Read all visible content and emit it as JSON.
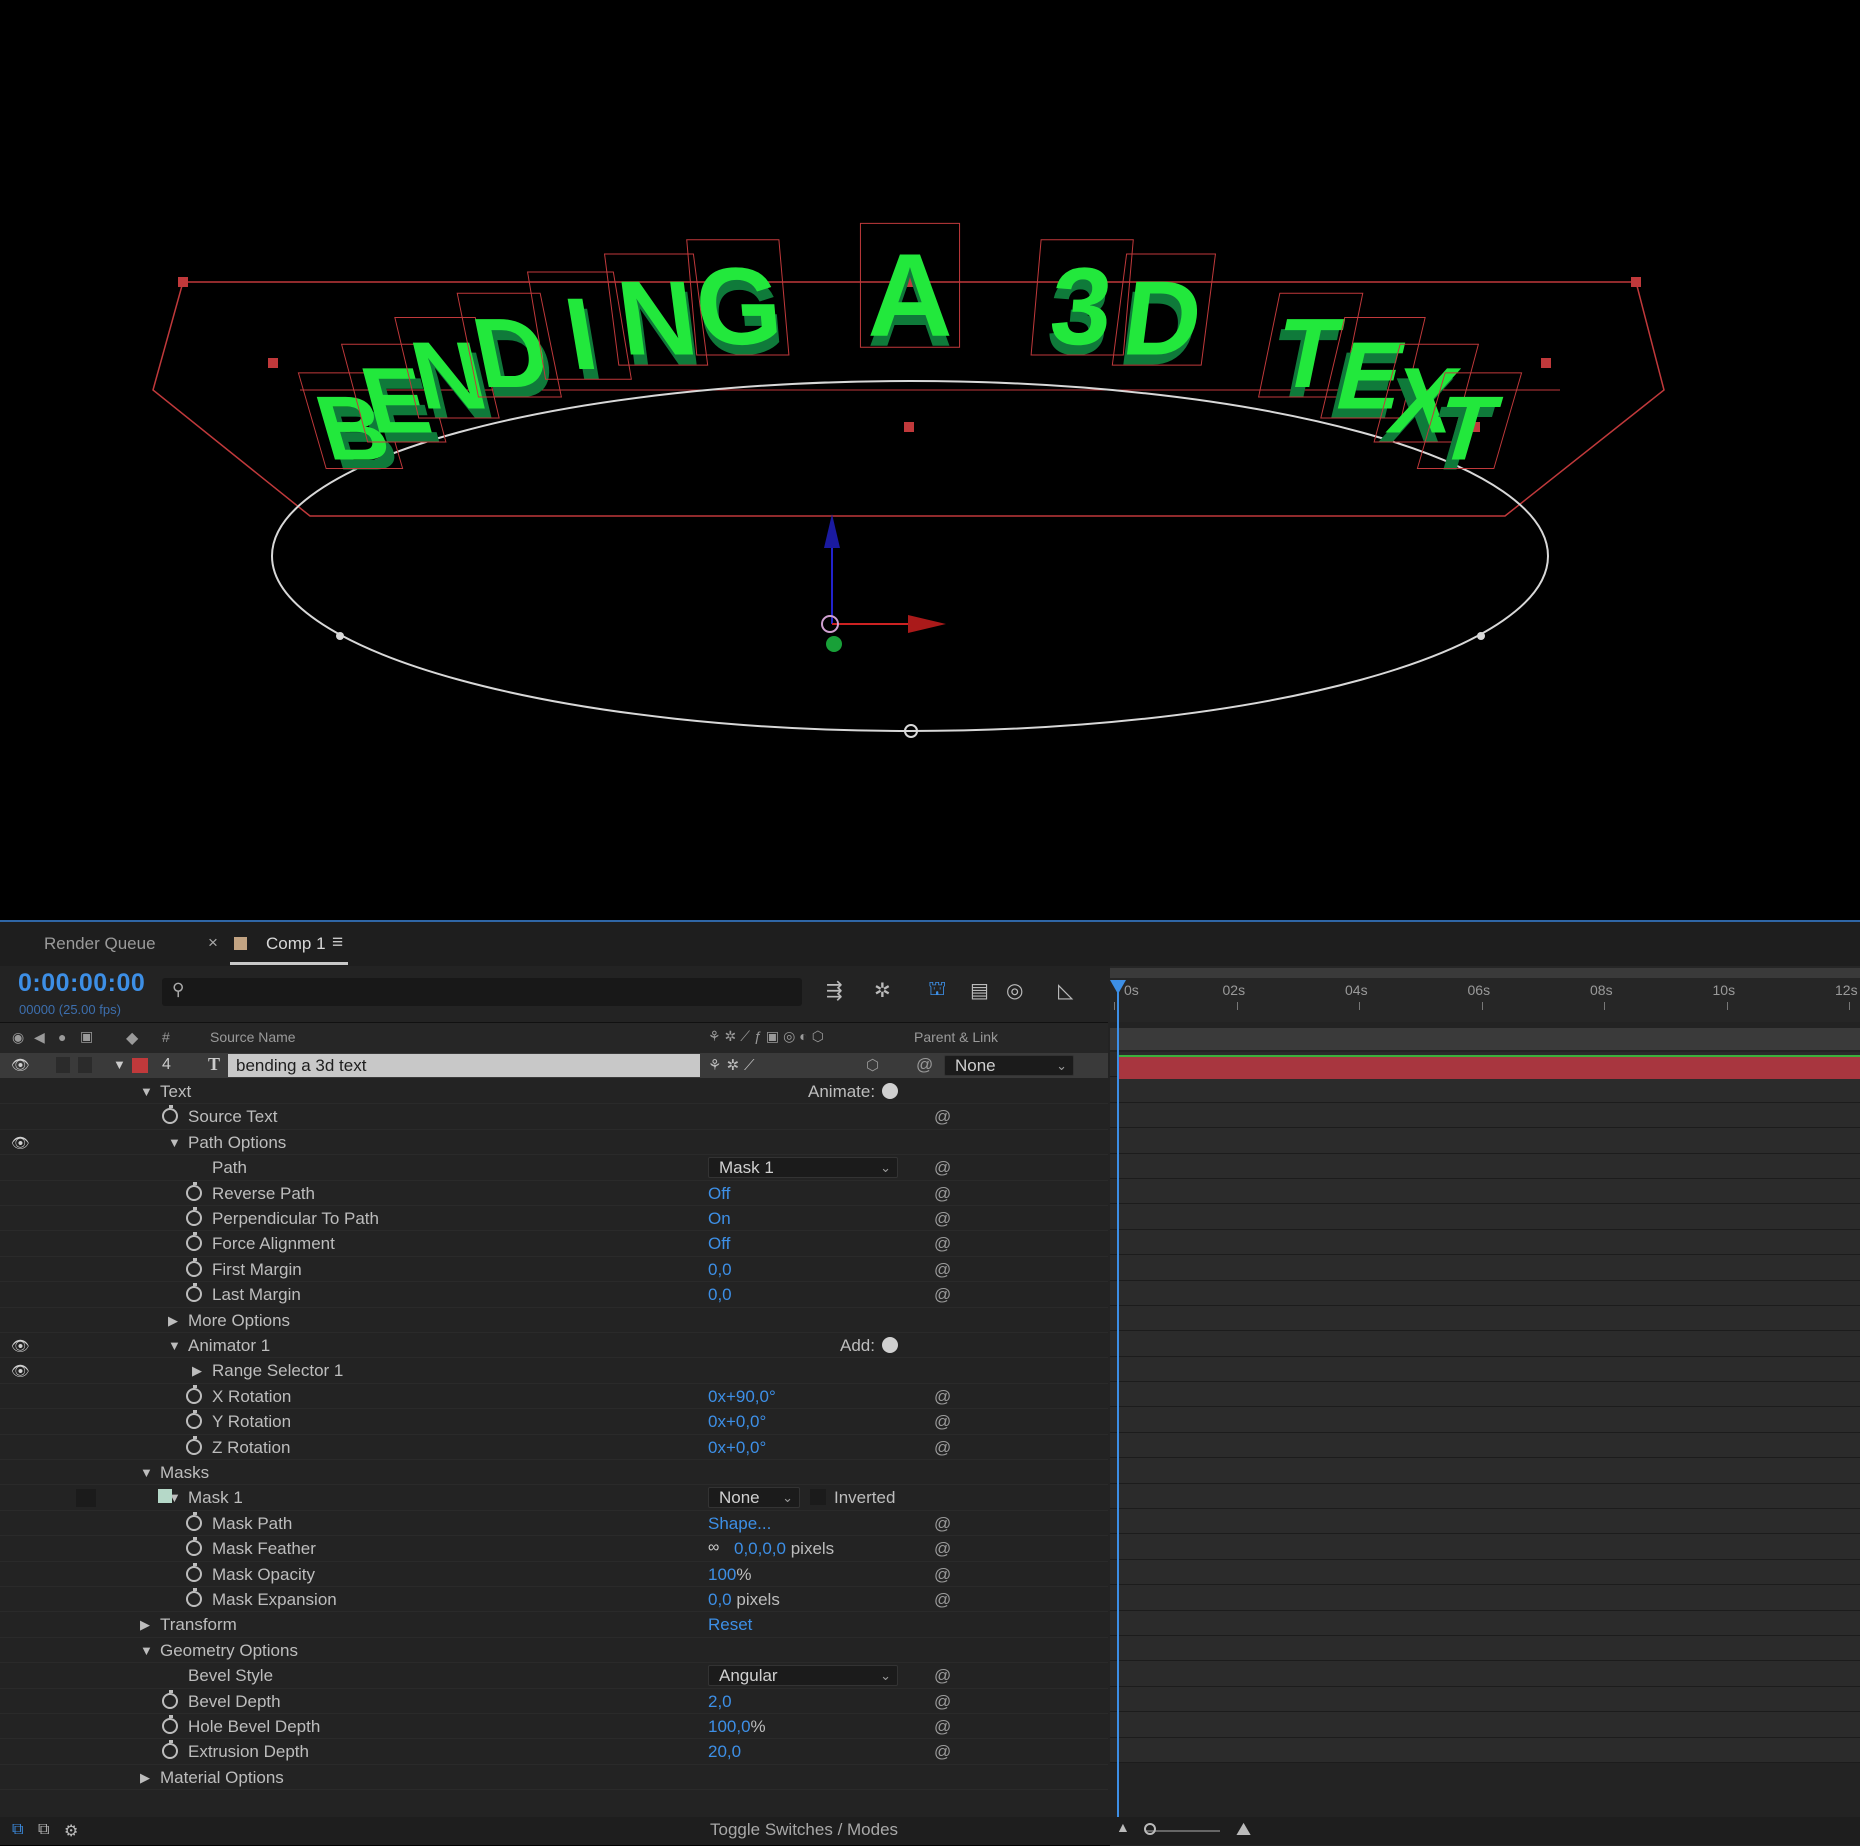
{
  "viewer": {
    "text_letters": [
      "B",
      "E",
      "N",
      "D",
      "I",
      "N",
      "G",
      " ",
      "A",
      " ",
      "3",
      "D",
      " ",
      "T",
      "E",
      "X",
      "T"
    ],
    "colors": {
      "text_face": "#22e83c",
      "text_side": "#0f7a3a",
      "bbox": "#c0393b",
      "path": "#d8d8d8"
    }
  },
  "tabs": {
    "render_queue": "Render Queue",
    "close": "×",
    "comp": "Comp 1",
    "menu": "≡"
  },
  "header": {
    "timecode": "0:00:00:00",
    "frames": "00000 (25.00 fps)",
    "search_placeholder": ""
  },
  "columns": {
    "hash": "#",
    "source_name": "Source Name",
    "parent_link": "Parent & Link"
  },
  "layer": {
    "number": "4",
    "type_icon": "T",
    "name": "bending a 3d text",
    "parent": "None",
    "label_color": "#c0393b"
  },
  "properties": [
    {
      "label": "Text",
      "indent": 0,
      "twirl": "open",
      "value": "",
      "right": "Animate:"
    },
    {
      "label": "Source Text",
      "indent": 1,
      "stopwatch": true,
      "value": "",
      "pw": true
    },
    {
      "label": "Path Options",
      "indent": 1,
      "twirl": "open",
      "value": "",
      "eye": true
    },
    {
      "label": "Path",
      "indent": 2,
      "dropdown": "Mask 1",
      "pw": true
    },
    {
      "label": "Reverse Path",
      "indent": 2,
      "stopwatch": true,
      "value": "Off",
      "pw": true
    },
    {
      "label": "Perpendicular To Path",
      "indent": 2,
      "stopwatch": true,
      "value": "On",
      "pw": true
    },
    {
      "label": "Force Alignment",
      "indent": 2,
      "stopwatch": true,
      "value": "Off",
      "pw": true
    },
    {
      "label": "First Margin",
      "indent": 2,
      "stopwatch": true,
      "value": "0,0",
      "pw": true
    },
    {
      "label": "Last Margin",
      "indent": 2,
      "stopwatch": true,
      "value": "0,0",
      "pw": true
    },
    {
      "label": "More Options",
      "indent": 1,
      "twirl": "closed",
      "value": ""
    },
    {
      "label": "Animator 1",
      "indent": 1,
      "twirl": "open",
      "value": "",
      "right": "Add:",
      "eye": true
    },
    {
      "label": "Range Selector 1",
      "indent": 2,
      "twirl": "closed",
      "value": "",
      "eye": true
    },
    {
      "label": "X Rotation",
      "indent": 2,
      "stopwatch": true,
      "value": "0x+90,0°",
      "pw": true
    },
    {
      "label": "Y Rotation",
      "indent": 2,
      "stopwatch": true,
      "value": "0x+0,0°",
      "pw": true
    },
    {
      "label": "Z Rotation",
      "indent": 2,
      "stopwatch": true,
      "value": "0x+0,0°",
      "pw": true
    },
    {
      "label": "Masks",
      "indent": 0,
      "twirl": "open",
      "value": ""
    },
    {
      "label": "Mask 1",
      "indent": 1,
      "twirl": "open",
      "value": "",
      "maskmode": "None",
      "inverted": "Inverted"
    },
    {
      "label": "Mask Path",
      "indent": 2,
      "stopwatch": true,
      "value": "Shape...",
      "pw": true
    },
    {
      "label": "Mask Feather",
      "indent": 2,
      "stopwatch": true,
      "value": "0,0,0,0",
      "unit": " pixels",
      "link": true,
      "pw": true
    },
    {
      "label": "Mask Opacity",
      "indent": 2,
      "stopwatch": true,
      "value": "100",
      "unit": "%",
      "pw": true
    },
    {
      "label": "Mask Expansion",
      "indent": 2,
      "stopwatch": true,
      "value": "0,0",
      "unit": " pixels",
      "pw": true
    },
    {
      "label": "Transform",
      "indent": 0,
      "twirl": "closed",
      "value": "Reset"
    },
    {
      "label": "Geometry Options",
      "indent": 0,
      "twirl": "open",
      "value": ""
    },
    {
      "label": "Bevel Style",
      "indent": 1,
      "dropdown": "Angular",
      "pw": true
    },
    {
      "label": "Bevel Depth",
      "indent": 1,
      "stopwatch": true,
      "value": "2,0",
      "pw": true
    },
    {
      "label": "Hole Bevel Depth",
      "indent": 1,
      "stopwatch": true,
      "value": "100,0",
      "unit": "%",
      "pw": true
    },
    {
      "label": "Extrusion Depth",
      "indent": 1,
      "stopwatch": true,
      "value": "20,0",
      "pw": true
    },
    {
      "label": "Material Options",
      "indent": 0,
      "twirl": "closed",
      "value": ""
    }
  ],
  "timeline": {
    "ticks": [
      "0s",
      "02s",
      "04s",
      "06s",
      "08s",
      "10s",
      "12s"
    ],
    "layer_bar_color": "#a8363f"
  },
  "footer": {
    "toggle": "Toggle Switches / Modes"
  }
}
